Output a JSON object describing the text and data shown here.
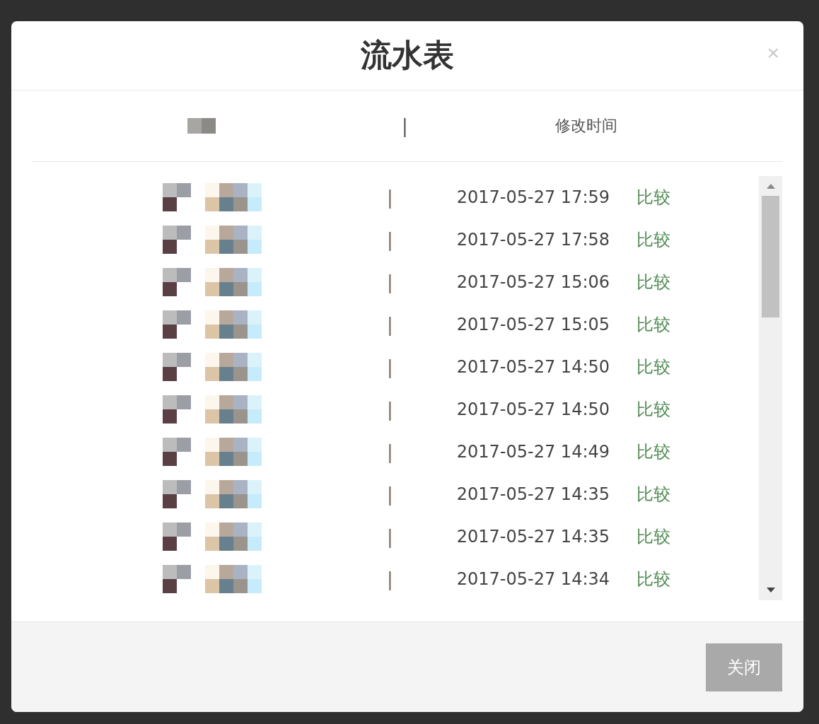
{
  "dialog": {
    "title": "流水表",
    "close_label": "×"
  },
  "table": {
    "header": {
      "divider": "|",
      "column_2": "修改时间"
    },
    "rows": [
      {
        "divider": "|",
        "time": "2017-05-27 17:59",
        "action": "比较"
      },
      {
        "divider": "|",
        "time": "2017-05-27 17:58",
        "action": "比较"
      },
      {
        "divider": "|",
        "time": "2017-05-27 15:06",
        "action": "比较"
      },
      {
        "divider": "|",
        "time": "2017-05-27 15:05",
        "action": "比较"
      },
      {
        "divider": "|",
        "time": "2017-05-27 14:50",
        "action": "比较"
      },
      {
        "divider": "|",
        "time": "2017-05-27 14:50",
        "action": "比较"
      },
      {
        "divider": "|",
        "time": "2017-05-27 14:49",
        "action": "比较"
      },
      {
        "divider": "|",
        "time": "2017-05-27 14:35",
        "action": "比较"
      },
      {
        "divider": "|",
        "time": "2017-05-27 14:35",
        "action": "比较"
      },
      {
        "divider": "|",
        "time": "2017-05-27 14:34",
        "action": "比较"
      }
    ]
  },
  "footer": {
    "close_button": "关闭"
  }
}
